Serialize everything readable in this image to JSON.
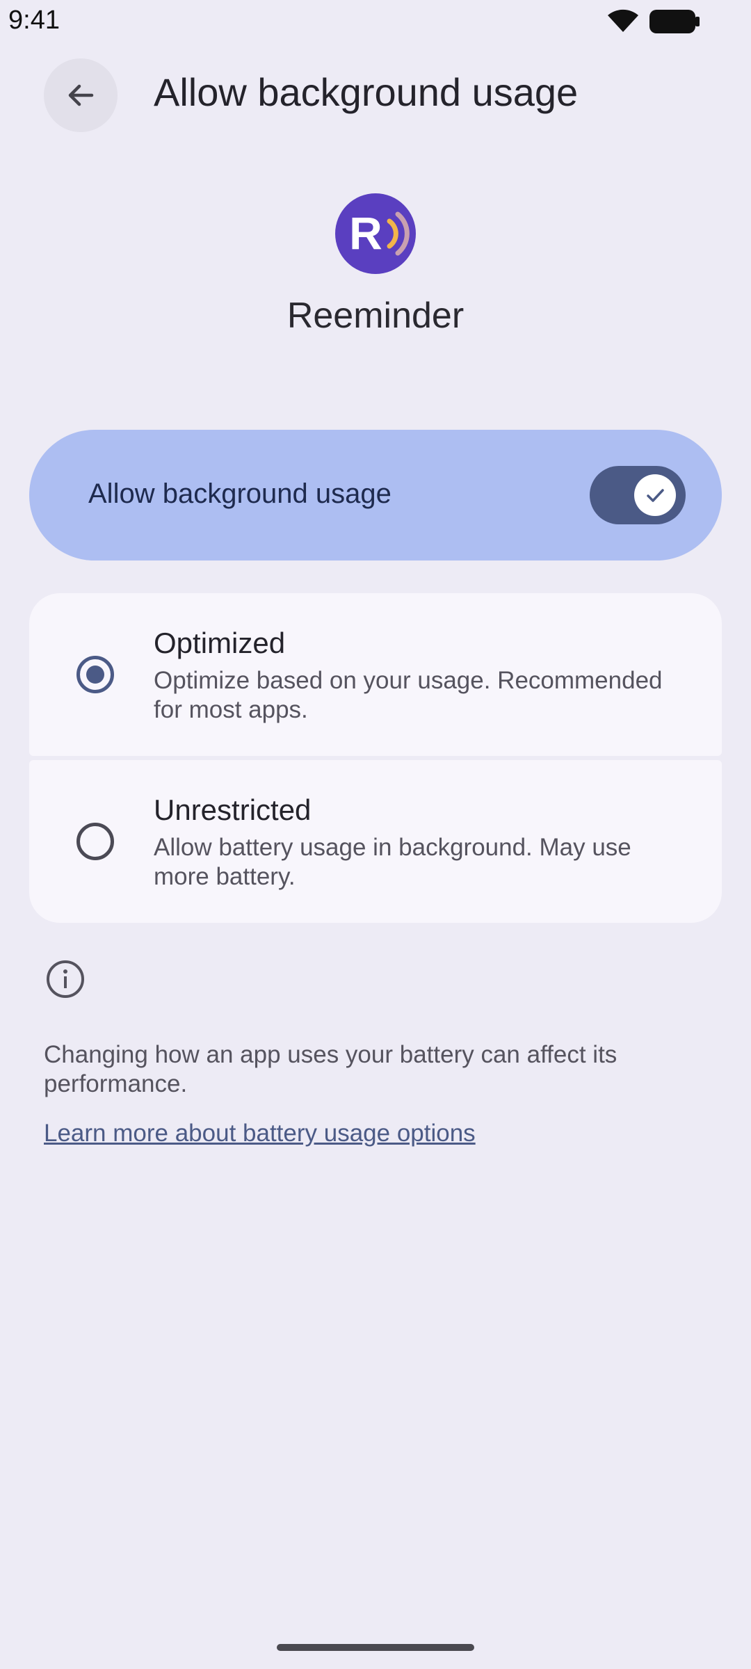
{
  "status_bar": {
    "time": "9:41",
    "icons": [
      "wifi-icon",
      "battery-icon"
    ]
  },
  "app_bar": {
    "back_icon": "arrow-back-icon",
    "title": "Allow background usage"
  },
  "app": {
    "name": "Reeminder",
    "icon": "reeminder-app-icon",
    "icon_color": "#5a3fc0",
    "icon_letter": "R"
  },
  "main_toggle": {
    "label": "Allow background usage",
    "state": "on",
    "accent_color": "#4b5a86",
    "card_color": "#adbef2"
  },
  "options": [
    {
      "title": "Optimized",
      "description": "Optimize based on your usage. Recommended for most apps.",
      "selected": true
    },
    {
      "title": "Unrestricted",
      "description": "Allow battery usage in background. May use more battery.",
      "selected": false
    }
  ],
  "footer": {
    "info_icon": "info-icon",
    "text": "Changing how an app uses your battery can affect its performance.",
    "link_text": "Learn more about battery usage options"
  }
}
